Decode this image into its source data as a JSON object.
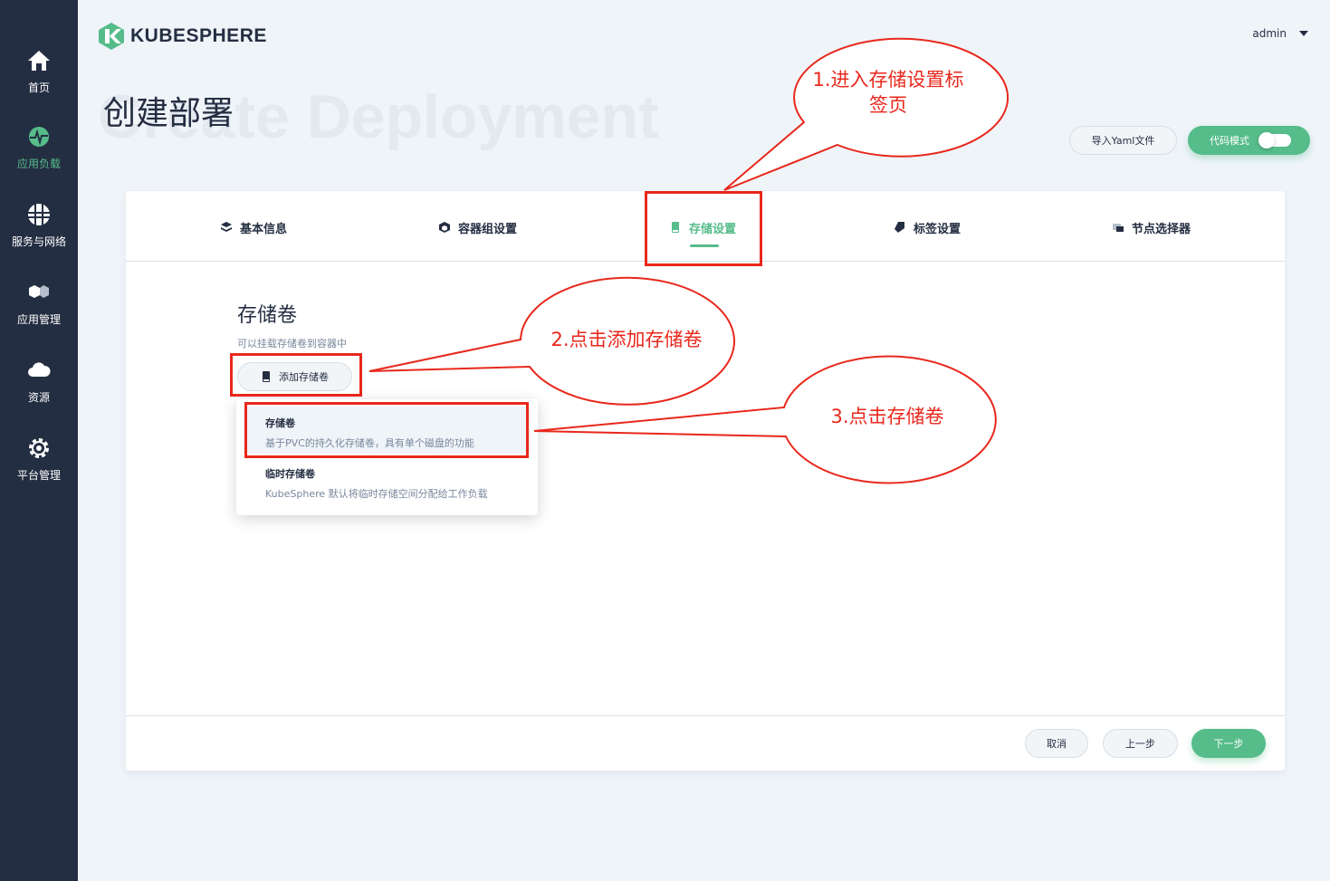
{
  "brand": {
    "name": "KUBESPHERE",
    "accent": "#55bc8a",
    "sidebar_bg": "#242e42",
    "annotation_color": "#e8281c"
  },
  "sidebar": {
    "items": [
      {
        "label": "首页",
        "icon": "home-icon"
      },
      {
        "label": "应用负载",
        "icon": "workload-icon",
        "active": true
      },
      {
        "label": "服务与网络",
        "icon": "network-icon"
      },
      {
        "label": "应用管理",
        "icon": "app-icon"
      },
      {
        "label": "资源",
        "icon": "cloud-icon"
      },
      {
        "label": "平台管理",
        "icon": "gear-icon"
      }
    ]
  },
  "header": {
    "user": "admin"
  },
  "page": {
    "bg_title": "Create Deployment",
    "title": "创建部署",
    "yaml_button": "导入Yaml文件",
    "code_mode": "代码模式"
  },
  "tabs": [
    {
      "label": "基本信息",
      "icon": "layers-icon"
    },
    {
      "label": "容器组设置",
      "icon": "cube-icon"
    },
    {
      "label": "存储设置",
      "icon": "storage-icon",
      "active": true
    },
    {
      "label": "标签设置",
      "icon": "tag-icon"
    },
    {
      "label": "节点选择器",
      "icon": "node-icon"
    }
  ],
  "storage": {
    "title": "存储卷",
    "description": "可以挂载存储卷到容器中",
    "add_button": "添加存储卷",
    "options": [
      {
        "title": "存储卷",
        "desc": "基于PVC的持久化存储卷，具有单个磁盘的功能"
      },
      {
        "title": "临时存储卷",
        "desc": "KubeSphere 默认将临时存储空间分配给工作负载"
      }
    ]
  },
  "footer": {
    "cancel": "取消",
    "prev": "上一步",
    "next": "下一步"
  },
  "annotations": {
    "step1_line1": "1.进入存储设置标",
    "step1_line2": "签页",
    "step2": "2.点击添加存储卷",
    "step3": "3.点击存储卷"
  }
}
